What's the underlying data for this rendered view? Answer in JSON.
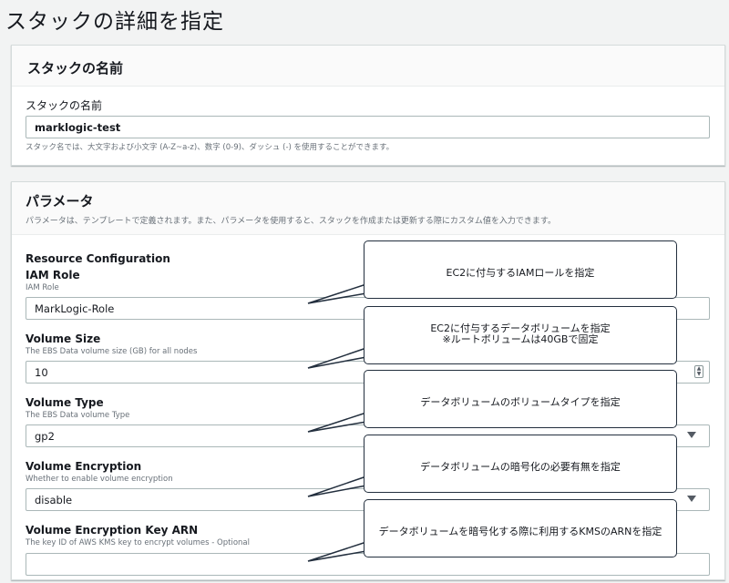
{
  "page": {
    "title": "スタックの詳細を指定"
  },
  "stack_name_panel": {
    "title": "スタックの名前",
    "field_label": "スタックの名前",
    "value": "marklogic-test",
    "hint": "スタック名では、大文字および小文字 (A-Z~a-z)、数字 (0-9)、ダッシュ (-) を使用することができます。"
  },
  "parameters_panel": {
    "title": "パラメータ",
    "description": "パラメータは、テンプレートで定義されます。また、パラメータを使用すると、スタックを作成または更新する際にカスタム値を入力できます。",
    "section_title": "Resource Configuration",
    "fields": [
      {
        "label": "IAM Role",
        "description": "IAM Role",
        "value": "MarkLogic-Role"
      },
      {
        "label": "Volume Size",
        "description": "The EBS Data volume size (GB) for all nodes",
        "value": "10"
      },
      {
        "label": "Volume Type",
        "description": "The EBS Data volume Type",
        "value": "gp2"
      },
      {
        "label": "Volume Encryption",
        "description": "Whether to enable volume encryption",
        "value": "disable"
      },
      {
        "label": "Volume Encryption Key ARN",
        "description": "The key ID of AWS KMS key to encrypt volumes - Optional",
        "value": ""
      }
    ]
  },
  "callouts": [
    {
      "line1": "EC2に付与するIAMロールを指定",
      "line2": ""
    },
    {
      "line1": "EC2に付与するデータボリュームを指定",
      "line2": "※ルートボリュームは40GBで固定"
    },
    {
      "line1": "データボリュームのボリュームタイプを指定",
      "line2": ""
    },
    {
      "line1": "データボリュームの暗号化の必要有無を指定",
      "line2": ""
    },
    {
      "line1": "データボリュームを暗号化する際に利用するKMSのARNを指定",
      "line2": ""
    }
  ],
  "icons": {
    "spinner": "spinner-icon",
    "dropdown": "chevron-down-icon"
  },
  "colors": {
    "accent": "#232f3e",
    "border": "#aab7b8",
    "muted": "#687078"
  }
}
